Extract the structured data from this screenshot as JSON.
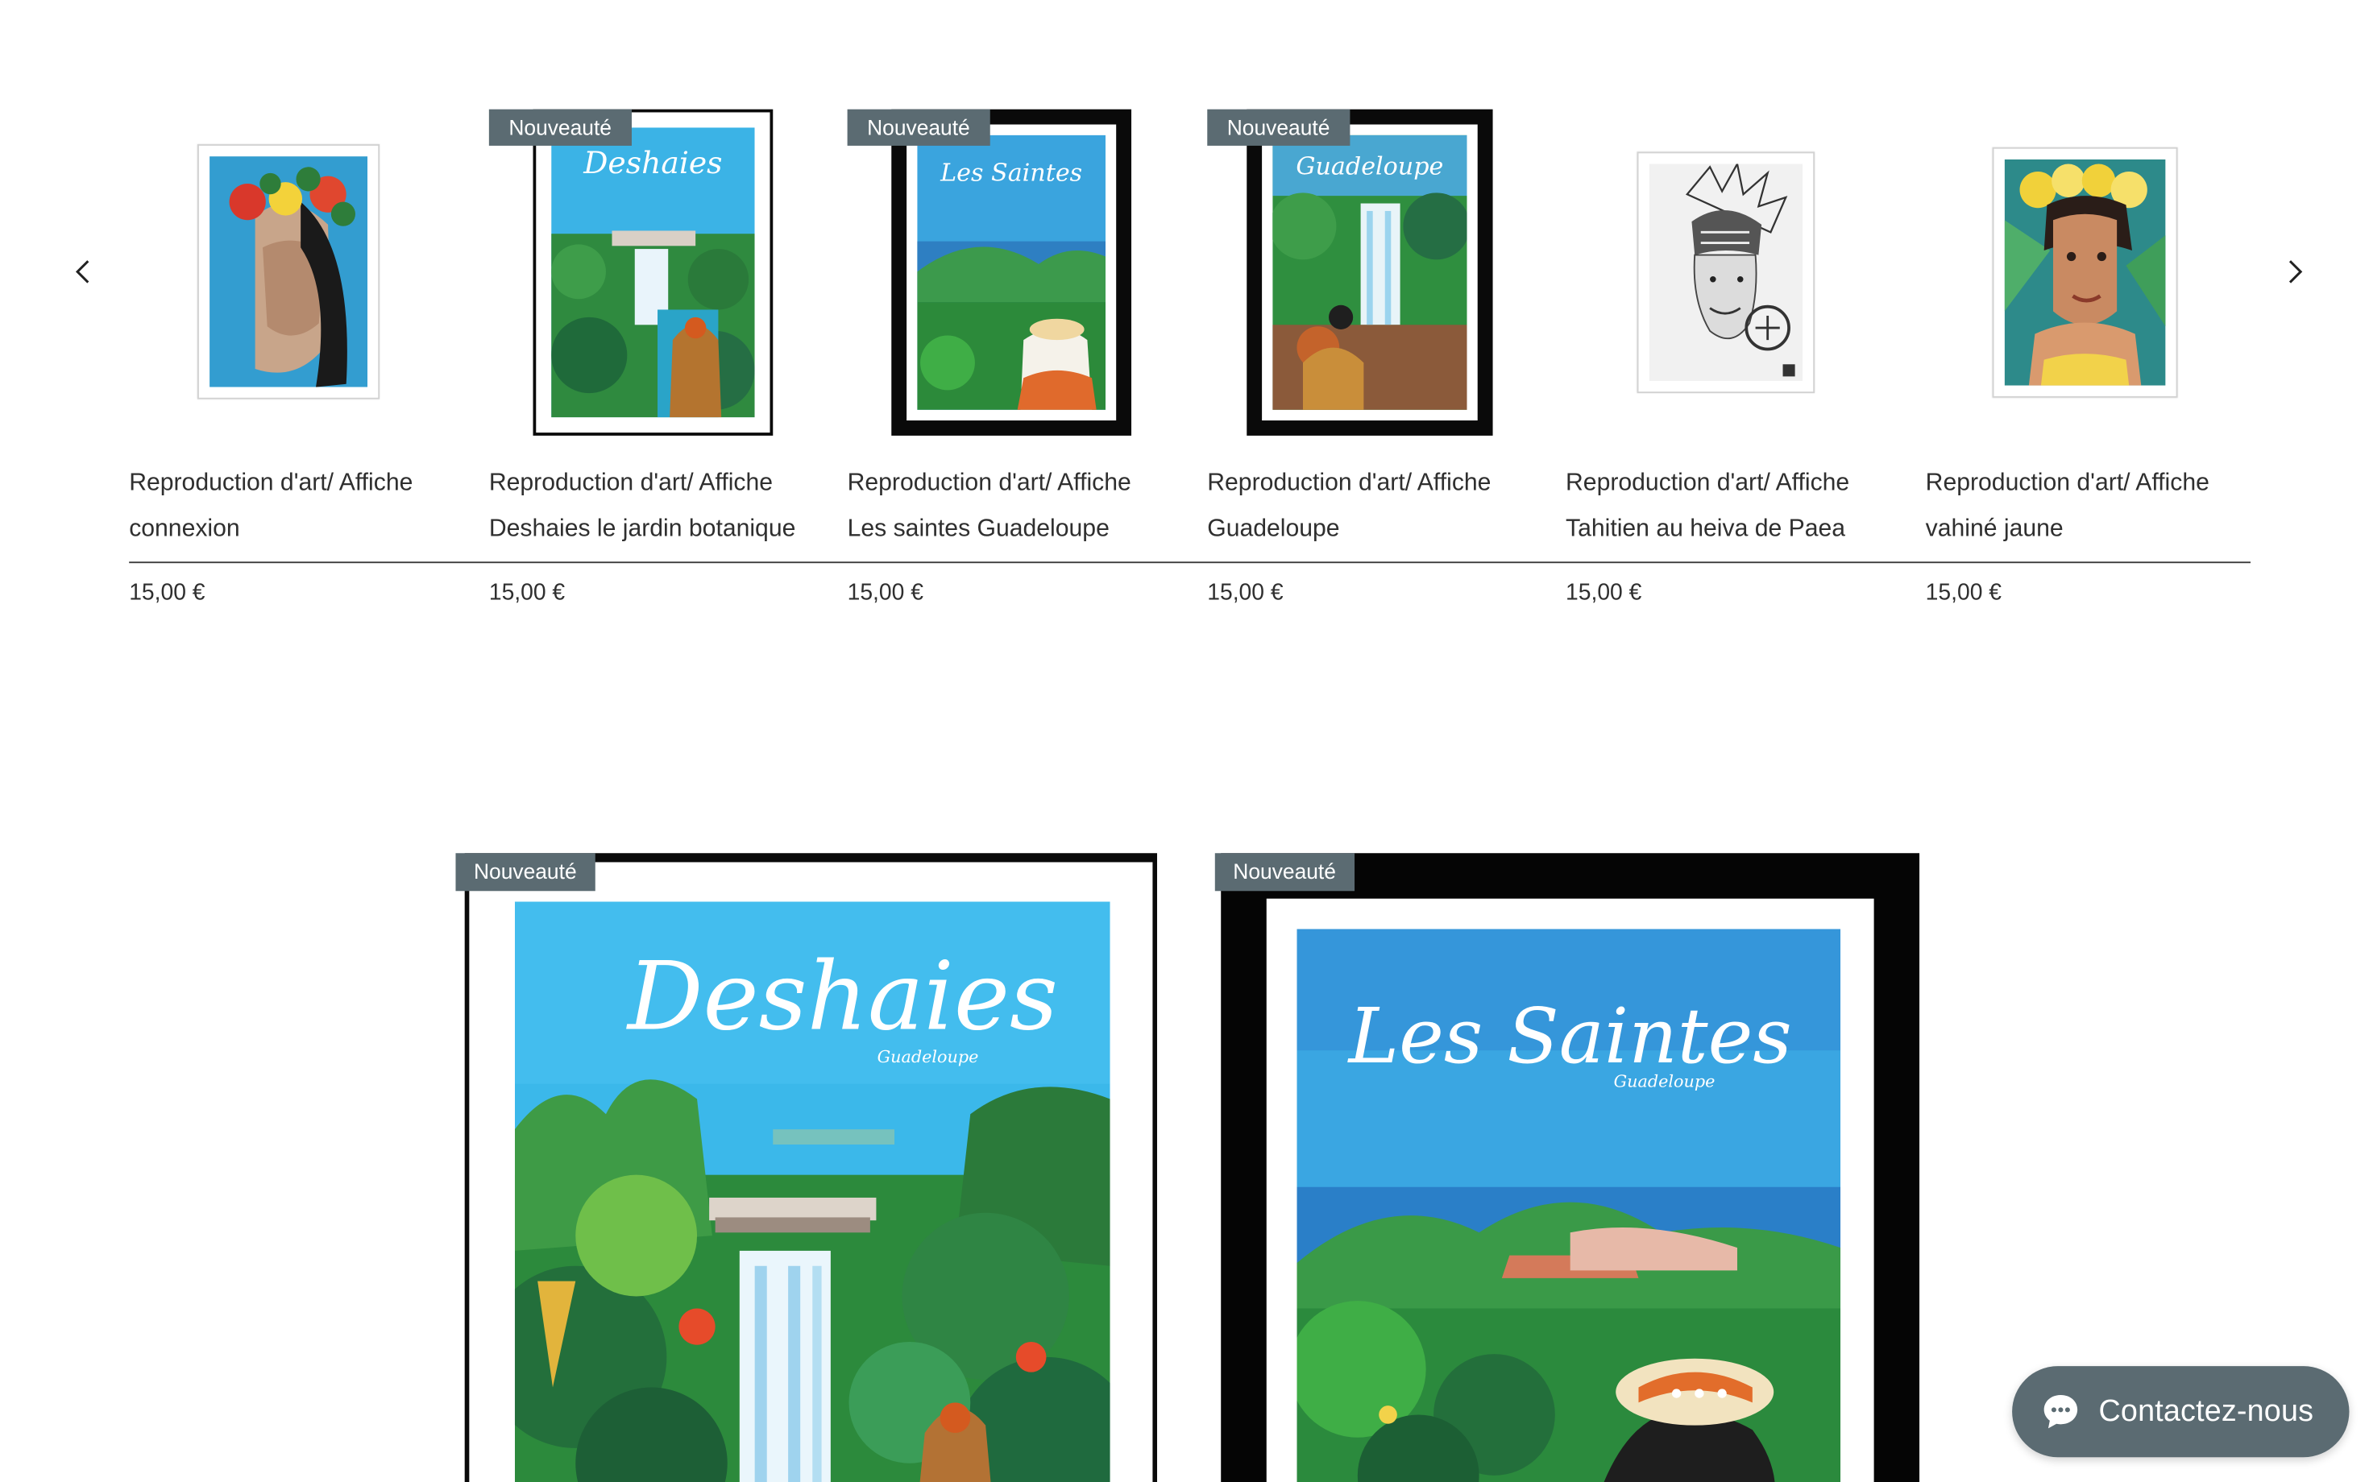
{
  "carousel": {
    "prev_icon": "chevron-left-icon",
    "next_icon": "chevron-right-icon",
    "products": [
      {
        "name_line1": "Reproduction d'art/ Affiche",
        "name_line2": "connexion",
        "price": "15,00 €",
        "badge": "",
        "frame": "white-thin"
      },
      {
        "name_line1": "Reproduction d'art/ Affiche",
        "name_line2": "Deshaies le jardin botanique",
        "price": "15,00 €",
        "badge": "Nouveauté",
        "frame": "black-thin",
        "poster_title": "Deshaies"
      },
      {
        "name_line1": "Reproduction d'art/ Affiche",
        "name_line2": "Les saintes Guadeloupe",
        "price": "15,00 €",
        "badge": "Nouveauté",
        "frame": "black-thick",
        "poster_title": "Les Saintes"
      },
      {
        "name_line1": "Reproduction d'art/ Affiche",
        "name_line2": "Guadeloupe",
        "price": "15,00 €",
        "badge": "Nouveauté",
        "frame": "black-thick",
        "poster_title": "Guadeloupe"
      },
      {
        "name_line1": "Reproduction d'art/ Affiche",
        "name_line2": "Tahitien au heiva de Paea",
        "price": "15,00 €",
        "badge": "",
        "frame": "white-thin"
      },
      {
        "name_line1": "Reproduction d'art/ Affiche",
        "name_line2": "vahiné jaune",
        "price": "15,00 €",
        "badge": "",
        "frame": "white-thin"
      }
    ]
  },
  "featured": [
    {
      "badge": "Nouveauté",
      "poster_title": "Deshaies",
      "poster_subtitle": "Guadeloupe"
    },
    {
      "badge": "Nouveauté",
      "poster_title": "Les Saintes",
      "poster_subtitle": "Guadeloupe"
    }
  ],
  "chat": {
    "label": "Contactez-nous",
    "icon": "chat-bubble-icon"
  },
  "colors": {
    "badge_bg": "#5b6b72",
    "chat_bg": "#5b6b72",
    "text": "#2f2f2f"
  }
}
